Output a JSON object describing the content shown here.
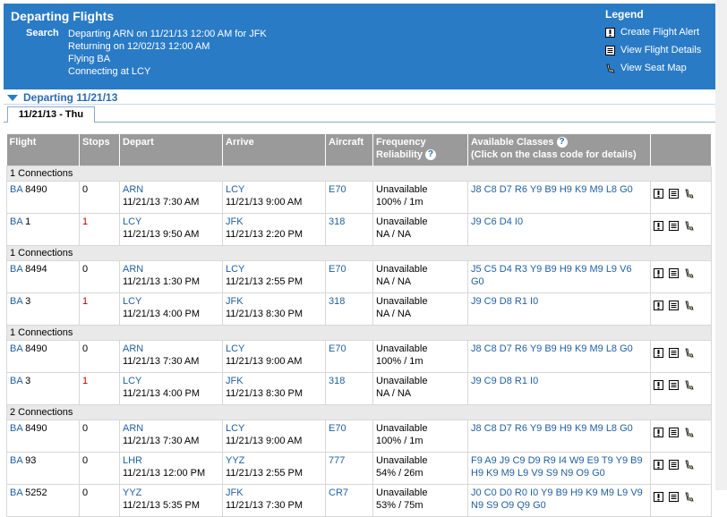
{
  "header": {
    "title": "Departing Flights",
    "search_label": "Search",
    "search_lines": [
      "Departing ARN on 11/21/13 12:00 AM for JFK",
      "Returning on 12/02/13 12:00 AM",
      "Flying BA",
      "Connecting at LCY"
    ]
  },
  "legend": {
    "title": "Legend",
    "items": [
      {
        "icon": "alert-icon",
        "label": "Create Flight Alert"
      },
      {
        "icon": "details-icon",
        "label": "View Flight Details"
      },
      {
        "icon": "seat-icon",
        "label": "View Seat Map"
      }
    ]
  },
  "section": {
    "label": "Departing 11/21/13"
  },
  "tab": {
    "label": "11/21/13 - Thu"
  },
  "columns": [
    "Flight",
    "Stops",
    "Depart",
    "Arrive",
    "Aircraft",
    "Frequency Reliability",
    "Available Classes",
    "(Click on the class code for details)"
  ],
  "groups": [
    {
      "label": "1 Connections",
      "rows": [
        {
          "airline": "BA",
          "number": "8490",
          "stops": "0",
          "dep_code": "ARN",
          "dep_time": "11/21/13 7:30 AM",
          "arr_code": "LCY",
          "arr_time": "11/21/13 9:00 AM",
          "aircraft": "E70",
          "freq1": "Unavailable",
          "freq2": "100% / 1m",
          "classes": "J8 C8 D7 R6 Y9 B9 H9 K9 M9 L8 G0"
        },
        {
          "airline": "BA",
          "number": "1",
          "stops": "1",
          "dep_code": "LCY",
          "dep_time": "11/21/13 9:50 AM",
          "arr_code": "JFK",
          "arr_time": "11/21/13 2:20 PM",
          "aircraft": "318",
          "freq1": "Unavailable",
          "freq2": "NA / NA",
          "classes": "J9 C6 D4 I0"
        }
      ]
    },
    {
      "label": "1 Connections",
      "rows": [
        {
          "airline": "BA",
          "number": "8494",
          "stops": "0",
          "dep_code": "ARN",
          "dep_time": "11/21/13 1:30 PM",
          "arr_code": "LCY",
          "arr_time": "11/21/13 2:55 PM",
          "aircraft": "E70",
          "freq1": "Unavailable",
          "freq2": "NA / NA",
          "classes": "J5 C5 D4 R3 Y9 B9 H9 K9 M9 L9 V6 G0"
        },
        {
          "airline": "BA",
          "number": "3",
          "stops": "1",
          "dep_code": "LCY",
          "dep_time": "11/21/13 4:00 PM",
          "arr_code": "JFK",
          "arr_time": "11/21/13 8:30 PM",
          "aircraft": "318",
          "freq1": "Unavailable",
          "freq2": "NA / NA",
          "classes": "J9 C9 D8 R1 I0"
        }
      ]
    },
    {
      "label": "1 Connections",
      "rows": [
        {
          "airline": "BA",
          "number": "8490",
          "stops": "0",
          "dep_code": "ARN",
          "dep_time": "11/21/13 7:30 AM",
          "arr_code": "LCY",
          "arr_time": "11/21/13 9:00 AM",
          "aircraft": "E70",
          "freq1": "Unavailable",
          "freq2": "100% / 1m",
          "classes": "J8 C8 D7 R6 Y9 B9 H9 K9 M9 L8 G0"
        },
        {
          "airline": "BA",
          "number": "3",
          "stops": "1",
          "dep_code": "LCY",
          "dep_time": "11/21/13 4:00 PM",
          "arr_code": "JFK",
          "arr_time": "11/21/13 8:30 PM",
          "aircraft": "318",
          "freq1": "Unavailable",
          "freq2": "NA / NA",
          "classes": "J9 C9 D8 R1 I0"
        }
      ]
    },
    {
      "label": "2 Connections",
      "rows": [
        {
          "airline": "BA",
          "number": "8490",
          "stops": "0",
          "dep_code": "ARN",
          "dep_time": "11/21/13 7:30 AM",
          "arr_code": "LCY",
          "arr_time": "11/21/13 9:00 AM",
          "aircraft": "E70",
          "freq1": "Unavailable",
          "freq2": "100% / 1m",
          "classes": "J8 C8 D7 R6 Y9 B9 H9 K9 M9 L8 G0"
        },
        {
          "airline": "BA",
          "number": "93",
          "stops": "0",
          "dep_code": "LHR",
          "dep_time": "11/21/13 12:00 PM",
          "arr_code": "YYZ",
          "arr_time": "11/21/13 2:55 PM",
          "aircraft": "777",
          "freq1": "Unavailable",
          "freq2": "54% / 26m",
          "classes": "F9 A9 J9 C9 D9 R9 I4 W9 E9 T9 Y9 B9 H9 K9 M9 L9 V9 S9 N9 O9 G0"
        },
        {
          "airline": "BA",
          "number": "5252",
          "stops": "0",
          "dep_code": "YYZ",
          "dep_time": "11/21/13 5:35 PM",
          "arr_code": "JFK",
          "arr_time": "11/21/13 7:30 PM",
          "aircraft": "CR7",
          "freq1": "Unavailable",
          "freq2": "53% / 75m",
          "classes": "J0 C0 D0 R0 I0 Y9 B9 H9 K9 M9 L9 V9 N9 S9 O9 Q9 G0"
        }
      ]
    }
  ],
  "colors": {
    "header_bg": "#2a7bc6",
    "header_gray": "#9a9a9a",
    "link": "#1f5f9f",
    "stops_red": "#c00000"
  }
}
